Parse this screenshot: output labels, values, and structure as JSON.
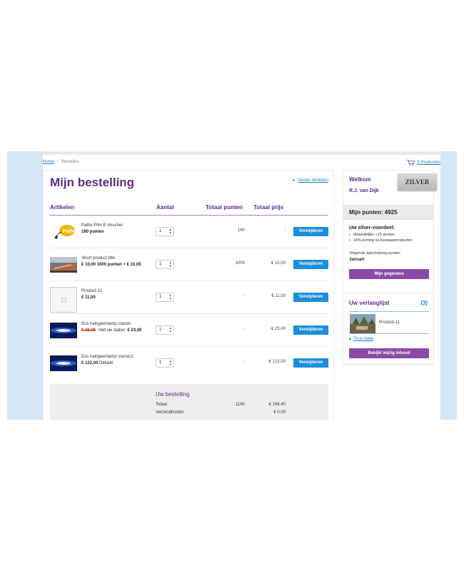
{
  "breadcrumb": {
    "home": "Home",
    "separator": "›",
    "current": "Bestellen"
  },
  "cart": {
    "label": "5 Producten",
    "icon": "cart-icon"
  },
  "main": {
    "title": "Mijn bestelling",
    "continue_label": "Verder winkelen",
    "columns": {
      "articles": "Artikelen",
      "quantity": "Aantal",
      "total_points": "Totaal punten",
      "total_price": "Totaal prijs"
    },
    "rows": [
      {
        "name": "Pathé Film E-Voucher",
        "price_bold": "180 punten",
        "price_old": "",
        "price_rest": "",
        "qty": "1",
        "points": "180",
        "price": "-",
        "remove": "Verwijderen",
        "thumb": "pathe-logo"
      },
      {
        "name": "Short product title",
        "price_bold": "€ 10,00 1000 punten + € 10,00",
        "price_old": "",
        "price_rest": "",
        "qty": "1",
        "points": "1000",
        "price": "€ 10,00",
        "remove": "Verwijderen",
        "thumb": "train-photo"
      },
      {
        "name": "Product-11",
        "price_bold": "€ 11,00",
        "price_old": "",
        "price_rest": "",
        "qty": "1",
        "points": "-",
        "price": "€ 11,00",
        "remove": "Verwijderen",
        "thumb": "broken-image"
      },
      {
        "name": "Eco halogeenlamp classic",
        "price_bold": "€ 23,40",
        "price_old": "€ 26,00",
        "price_rest": "met uw status:",
        "qty": "1",
        "points": "-",
        "price": "€ 23,40",
        "remove": "Verwijderen",
        "thumb": "lamp-photo"
      },
      {
        "name": "Eco halogeenlamp classic1",
        "price_bold": "€ 122,00",
        "price_old": "",
        "price_rest": "Default",
        "qty": "1",
        "points": "-",
        "price": "€ 122,00",
        "remove": "Verwijderen",
        "thumb": "lamp-photo"
      }
    ],
    "summary": {
      "title": "Uw bestelling",
      "total_label": "Totaal",
      "total_points": "1180",
      "total_price": "€ 166,40",
      "shipping_label": "Verzendkosten",
      "shipping_price": "€ 0,00"
    }
  },
  "sidebar": {
    "welcome": "Welkom",
    "user": "R.J. van Dijk",
    "status_badge": "ZILVER",
    "points": "Mijn punten: 4925",
    "advantage_title": "Uw zilver-voordeel:",
    "advantages": [
      "Maandelijks +15 punten",
      "10% korting op bespaarproducten"
    ],
    "next_label": "Volgende bijschrijving punten:",
    "next_value": "Januari",
    "details_button": "Mijn gegevens",
    "wishlist_title": "Uw verlanglijst",
    "wishlist_count": "(3)",
    "wishlist_item": "Product-11",
    "more_label": "Toon meer",
    "view_button": "Bekijk/ wijzig inhoud"
  },
  "colors": {
    "frame": "#d6e6f4",
    "purple": "#5b2d86",
    "button_blue": "#1a8fdb",
    "button_purple": "#8c4aa6",
    "link": "#1f7fc4"
  }
}
